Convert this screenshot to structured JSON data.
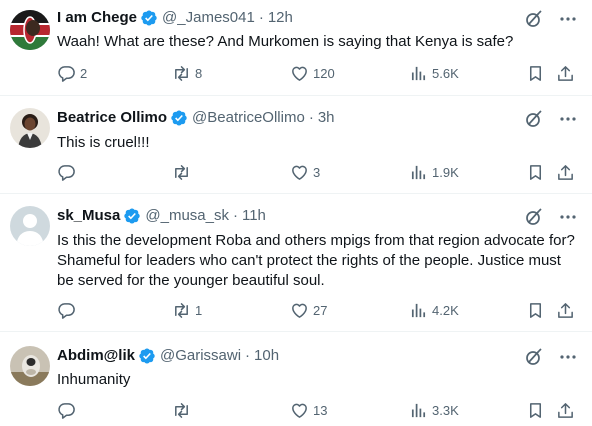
{
  "colors": {
    "verified": "#1d9bf0",
    "icon": "#536471",
    "text": "#0f1419",
    "divider": "#eff3f4"
  },
  "replies": [
    {
      "name": "I am Chege",
      "handle": "@_James041",
      "sep": "·",
      "time": "12h",
      "text": "Waah! What are these? And Murkomen is saying that Kenya is safe?",
      "reply_count": "2",
      "retweet_count": "8",
      "like_count": "120",
      "view_count": "5.6K"
    },
    {
      "name": "Beatrice Ollimo",
      "handle": "@BeatriceOllimo",
      "sep": "·",
      "time": "3h",
      "text": "This is cruel!!!",
      "reply_count": "",
      "retweet_count": "",
      "like_count": "3",
      "view_count": "1.9K"
    },
    {
      "name": "sk_Musa",
      "handle": "@_musa_sk",
      "sep": "·",
      "time": "11h",
      "text": "Is this the development Roba and others mpigs from that region advocate for? Shameful for leaders who can't protect the rights of the people. Justice must be served for the younger beautiful soul.",
      "reply_count": "",
      "retweet_count": "1",
      "like_count": "27",
      "view_count": "4.2K"
    },
    {
      "name": "Abdim@lik",
      "handle": "@Garissawi",
      "sep": "·",
      "time": "10h",
      "text": "Inhumanity",
      "reply_count": "",
      "retweet_count": "",
      "like_count": "13",
      "view_count": "3.3K"
    }
  ],
  "icons": [
    "verified-badge-icon",
    "grok-icon",
    "more-icon",
    "reply-icon",
    "retweet-icon",
    "like-icon",
    "views-icon",
    "bookmark-icon",
    "share-icon"
  ]
}
